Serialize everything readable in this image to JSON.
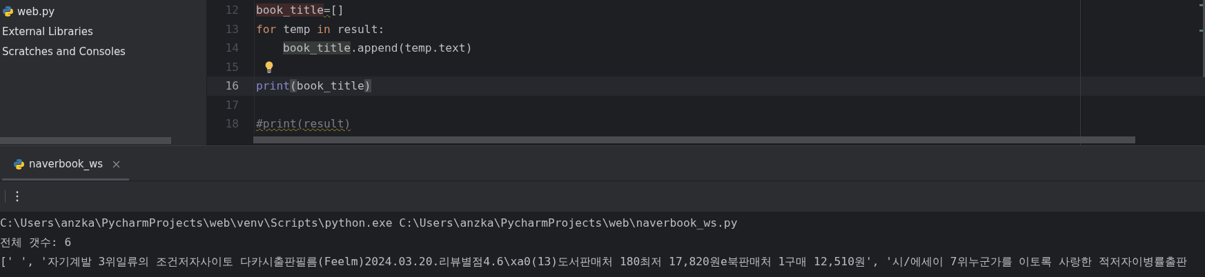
{
  "project_tree": {
    "items": [
      {
        "label": "web.py",
        "kind": "python-file"
      },
      {
        "label": "External Libraries",
        "kind": "plain"
      },
      {
        "label": "Scratches and Consoles",
        "kind": "plain"
      }
    ]
  },
  "editor": {
    "lines": [
      {
        "number": "12",
        "current": false,
        "bulb": false,
        "tokens": [
          {
            "text": "book_title",
            "kind": "write-usage"
          },
          {
            "text": "=",
            "kind": "weak-warning"
          },
          {
            "text": "[]",
            "kind": "plain"
          }
        ]
      },
      {
        "number": "13",
        "current": false,
        "bulb": false,
        "tokens": [
          {
            "text": "for",
            "kind": "keyword"
          },
          {
            "text": " temp ",
            "kind": "plain"
          },
          {
            "text": "in",
            "kind": "keyword"
          },
          {
            "text": " result:",
            "kind": "plain"
          }
        ]
      },
      {
        "number": "14",
        "current": false,
        "bulb": false,
        "indented": true,
        "tokens": [
          {
            "text": "book_title",
            "kind": "read-usage"
          },
          {
            "text": ".append(temp.text)",
            "kind": "plain"
          }
        ]
      },
      {
        "number": "15",
        "current": false,
        "bulb": true
      },
      {
        "number": "16",
        "current": true,
        "bulb": false,
        "tokens": [
          {
            "text": "print",
            "kind": "builtin"
          },
          {
            "text": "(",
            "kind": "brace"
          },
          {
            "text": "book_title",
            "kind": "plain"
          },
          {
            "text": ")",
            "kind": "brace"
          }
        ]
      },
      {
        "number": "17",
        "current": false,
        "bulb": false
      },
      {
        "number": "18",
        "current": false,
        "bulb": false,
        "tokens": [
          {
            "text": "#print(result)",
            "kind": "comment-warning"
          }
        ]
      }
    ]
  },
  "run_panel": {
    "tabs": [
      {
        "label": "naverbook_ws",
        "selected": true
      }
    ],
    "output": [
      "C:\\Users\\anzka\\PycharmProjects\\web\\venv\\Scripts\\python.exe C:\\Users\\anzka\\PycharmProjects\\web\\naverbook_ws.py",
      "전체 갯수: 6",
      "[' ', '자기계발 3위일류의 조건저자사이토 다카시출판필름(Feelm)2024.03.20.리뷰별점4.6\\xa0(13)도서판매처 180최저 17,820원e북판매처 1구매 12,510원', '시/에세이 7위누군가를 이토록 사랑한 적저자이병률출판"
    ]
  }
}
